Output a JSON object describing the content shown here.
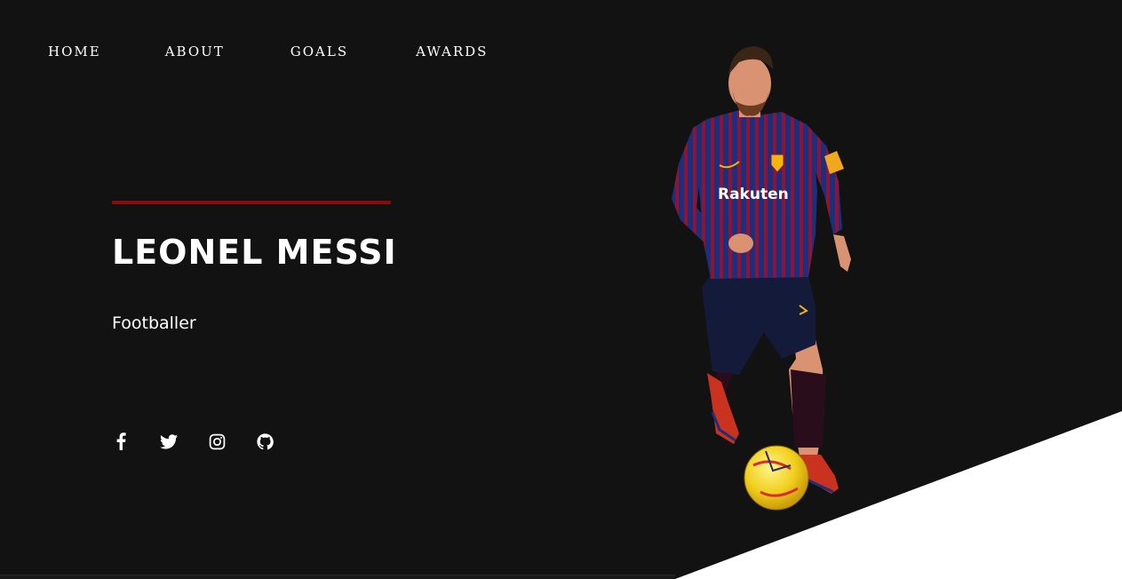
{
  "nav": {
    "items": [
      {
        "label": "HOME"
      },
      {
        "label": "ABOUT"
      },
      {
        "label": "GOALS"
      },
      {
        "label": "AWARDS"
      }
    ]
  },
  "hero": {
    "name": "LEONEL MESSI",
    "subtitle": "Footballer",
    "rule_color": "#8b0b0b"
  },
  "player": {
    "shirt_sponsor": "Rakuten",
    "kit_colors": [
      "#1d2e7a",
      "#8a1538"
    ]
  },
  "social": {
    "icons": [
      "facebook-icon",
      "twitter-icon",
      "instagram-icon",
      "github-icon"
    ]
  },
  "colors": {
    "background": "#121212",
    "accent": "#8b0b0b",
    "text": "#ffffff",
    "wedge": "#ffffff"
  }
}
